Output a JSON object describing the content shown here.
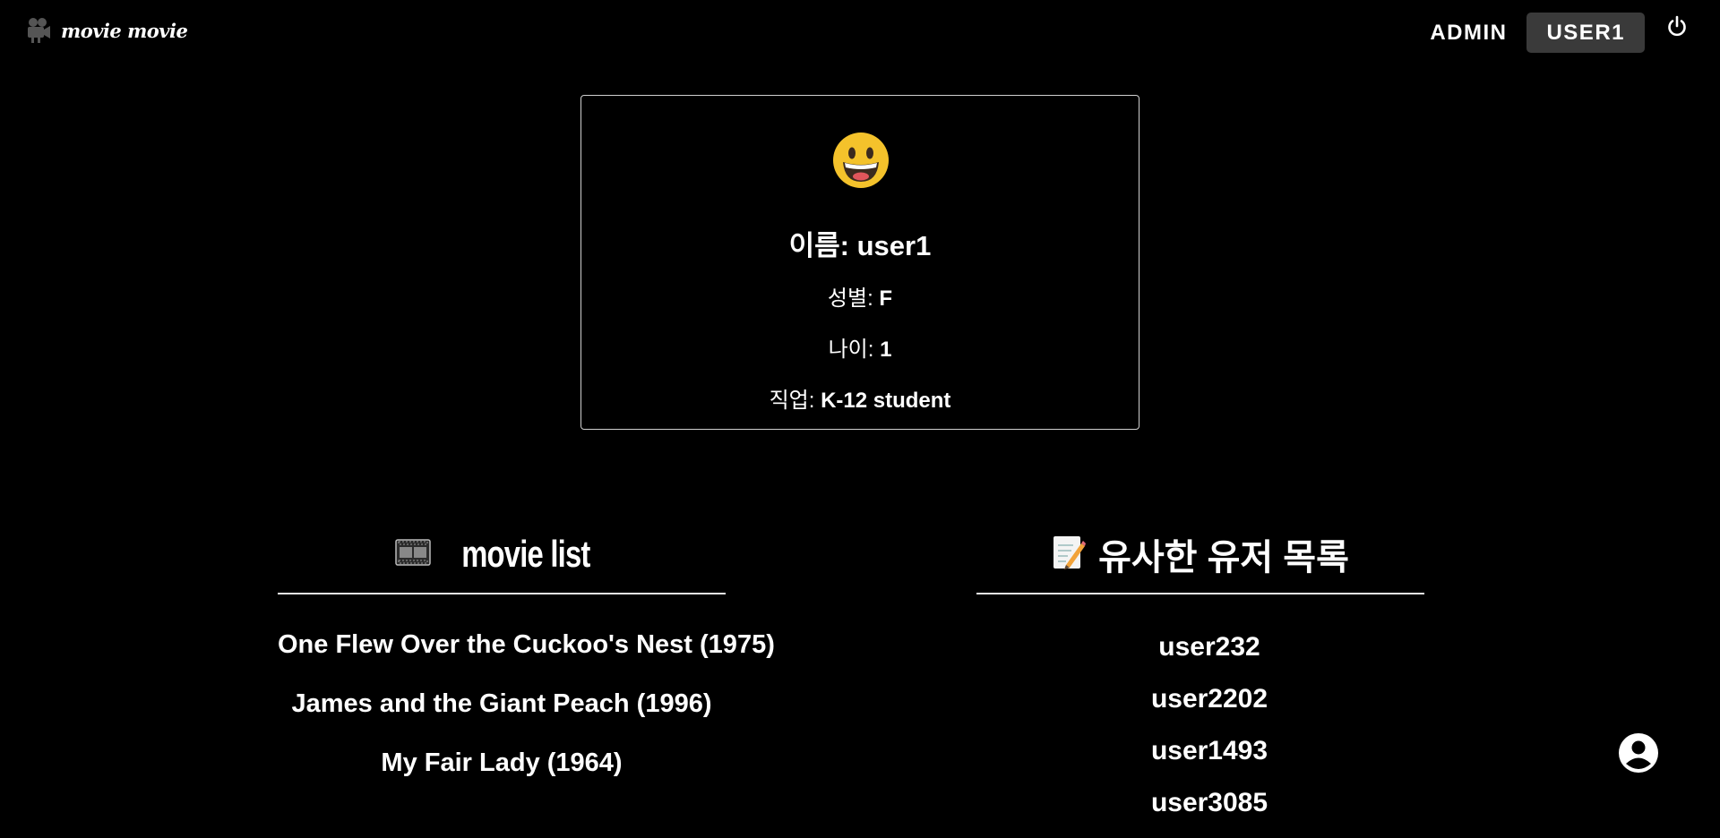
{
  "brand": {
    "name": "movie movie",
    "icon": "movie-camera-icon"
  },
  "nav": {
    "admin_label": "ADMIN",
    "user_label": "USER1",
    "power_icon": "power-icon"
  },
  "profile": {
    "avatar_icon": "grinning-face-icon",
    "name_label": "이름:",
    "name_value": "user1",
    "gender_label": "성별:",
    "gender_value": "F",
    "age_label": "나이:",
    "age_value": "1",
    "job_label": "직업:",
    "job_value": "K-12 student"
  },
  "movie_section": {
    "icon": "film-frames-icon",
    "title": "movie list",
    "items": [
      "One Flew Over the Cuckoo's Nest (1975)",
      "James and the Giant Peach (1996)",
      "My Fair Lady (1964)"
    ]
  },
  "similar_section": {
    "icon": "memo-icon",
    "title": "유사한 유저 목록",
    "items": [
      "user232",
      "user2202",
      "user1493",
      "user3085"
    ]
  },
  "fab": {
    "icon": "account-circle-icon"
  }
}
